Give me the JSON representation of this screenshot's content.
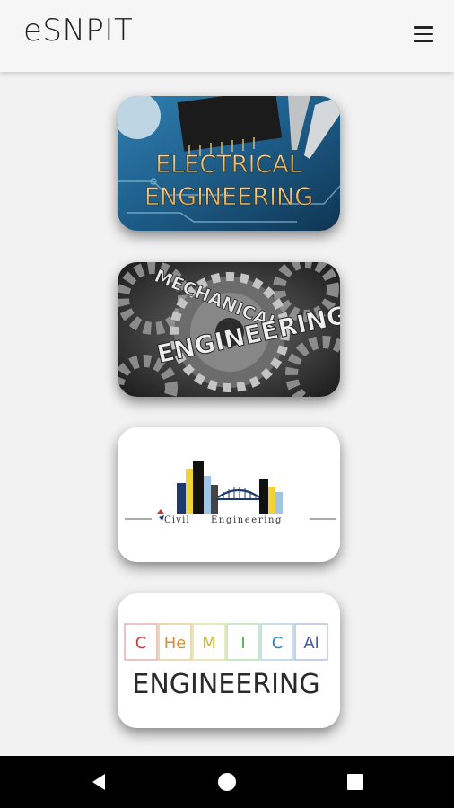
{
  "app": {
    "title": "eSNPIT",
    "menu_icon": "hamburger-menu-icon"
  },
  "cards": [
    {
      "name": "electrical",
      "line1": "ELECTRICAL",
      "line2": "ENGINEERING"
    },
    {
      "name": "mechanical",
      "line1": "MECHANICAL",
      "line2": "ENGINEERING"
    },
    {
      "name": "civil",
      "line1": "Civil",
      "line2": "Engineering"
    },
    {
      "name": "chemical",
      "elements": [
        "C",
        "He",
        "M",
        "I",
        "C",
        "Al"
      ],
      "line2": "ENGINEERING"
    }
  ],
  "navbar": {
    "icons": [
      "back-icon",
      "home-icon",
      "recents-icon"
    ]
  }
}
